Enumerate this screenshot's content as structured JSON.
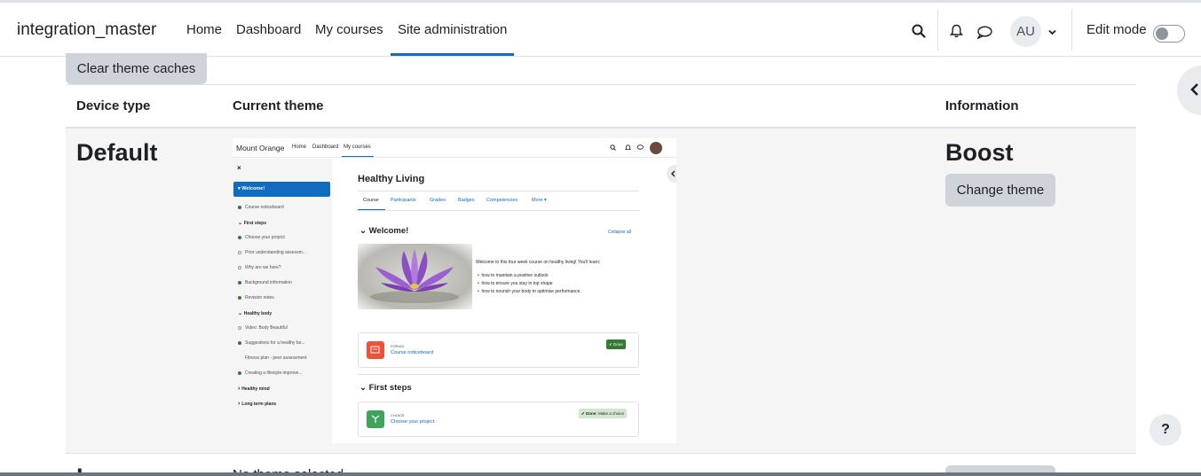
{
  "navbar": {
    "brand": "integration_master",
    "links": [
      "Home",
      "Dashboard",
      "My courses",
      "Site administration"
    ],
    "active_link": "Site administration",
    "avatar_initials": "AU",
    "edit_mode_label": "Edit mode",
    "edit_mode_on": false
  },
  "content": {
    "clear_caches_label": "Clear theme caches",
    "table_headers": {
      "device_type": "Device type",
      "current_theme": "Current theme",
      "information": "Information"
    },
    "rows": [
      {
        "device_type": "Default",
        "theme_name": "Boost",
        "change_label": "Change theme"
      },
      {
        "device_type": "L",
        "current_theme": "No theme selected"
      }
    ]
  },
  "preview": {
    "brand": "Mount Orange",
    "nav_links": [
      "Home",
      "Dashboard",
      "My courses"
    ],
    "sidebar_close": "×",
    "sidebar_active": "Welcome!",
    "sidebar_items": [
      {
        "label": "Course noticeboard",
        "status": "done",
        "bold": false
      },
      {
        "label": "First steps",
        "status": "section",
        "bold": true
      },
      {
        "label": "Choose your project",
        "status": "done",
        "bold": false
      },
      {
        "label": "Prior understanding assessm...",
        "status": "empty",
        "bold": false
      },
      {
        "label": "Why are we here?",
        "status": "empty",
        "bold": false
      },
      {
        "label": "Background information",
        "status": "done",
        "bold": false
      },
      {
        "label": "Revision notes",
        "status": "done",
        "bold": false
      },
      {
        "label": "Healthy body",
        "status": "section",
        "bold": true
      },
      {
        "label": "Video: Body Beautiful",
        "status": "empty",
        "bold": false
      },
      {
        "label": "Suggestions for a healthy bo...",
        "status": "done",
        "bold": false
      },
      {
        "label": "Fitness plan - peer assessment",
        "status": "none",
        "bold": false
      },
      {
        "label": "Creating a lifestyle improve...",
        "status": "done",
        "bold": false
      },
      {
        "label": "Healthy mind",
        "status": "collapsed",
        "bold": true
      },
      {
        "label": "Long term plans",
        "status": "collapsed",
        "bold": true
      }
    ],
    "course_title": "Healthy Living",
    "tabs": [
      "Course",
      "Participants",
      "Grades",
      "Badges",
      "Competencies",
      "More ▾"
    ],
    "section1_title": "Welcome!",
    "collapse_all": "Collapse all",
    "intro_text": "Welcome to this four week course on healthy living! You'll learn:",
    "bullets": [
      "how to maintain a positive outlook",
      "how to ensure you stay in top shape",
      "how to nourish your body to optimise performance."
    ],
    "forum_type": "FORUM",
    "forum_link": "Course noticeboard",
    "done_label": "✔ Done",
    "section2_title": "First steps",
    "choice_type": "CHOICE",
    "choice_link": "Choose your project",
    "choice_done": "✔ Done:",
    "choice_done_detail": "Make a choice"
  },
  "help_label": "?",
  "colors": {
    "accent": "#0f6cbf",
    "button_secondary": "#ced4da",
    "row_bg": "#f5f5f5",
    "done_green": "#357a32"
  }
}
